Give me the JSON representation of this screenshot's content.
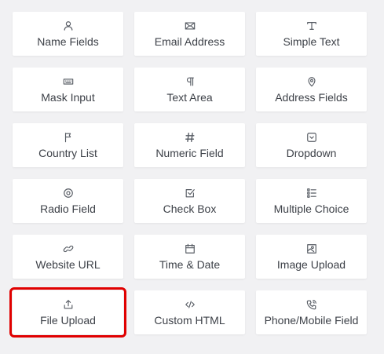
{
  "highlight_color": "#e00000",
  "fields": [
    {
      "label": "Name Fields",
      "icon": "user-icon"
    },
    {
      "label": "Email Address",
      "icon": "envelope-icon"
    },
    {
      "label": "Simple Text",
      "icon": "text-icon"
    },
    {
      "label": "Mask Input",
      "icon": "keyboard-icon"
    },
    {
      "label": "Text Area",
      "icon": "paragraph-icon"
    },
    {
      "label": "Address Fields",
      "icon": "map-pin-icon"
    },
    {
      "label": "Country List",
      "icon": "flag-icon"
    },
    {
      "label": "Numeric Field",
      "icon": "hash-icon"
    },
    {
      "label": "Dropdown",
      "icon": "dropdown-icon"
    },
    {
      "label": "Radio Field",
      "icon": "radio-icon"
    },
    {
      "label": "Check Box",
      "icon": "checkbox-icon"
    },
    {
      "label": "Multiple Choice",
      "icon": "list-icon"
    },
    {
      "label": "Website URL",
      "icon": "link-icon"
    },
    {
      "label": "Time & Date",
      "icon": "calendar-icon"
    },
    {
      "label": "Image Upload",
      "icon": "image-icon"
    },
    {
      "label": "File Upload",
      "icon": "upload-icon"
    },
    {
      "label": "Custom HTML",
      "icon": "code-icon"
    },
    {
      "label": "Phone/Mobile Field",
      "icon": "phone-icon"
    }
  ]
}
